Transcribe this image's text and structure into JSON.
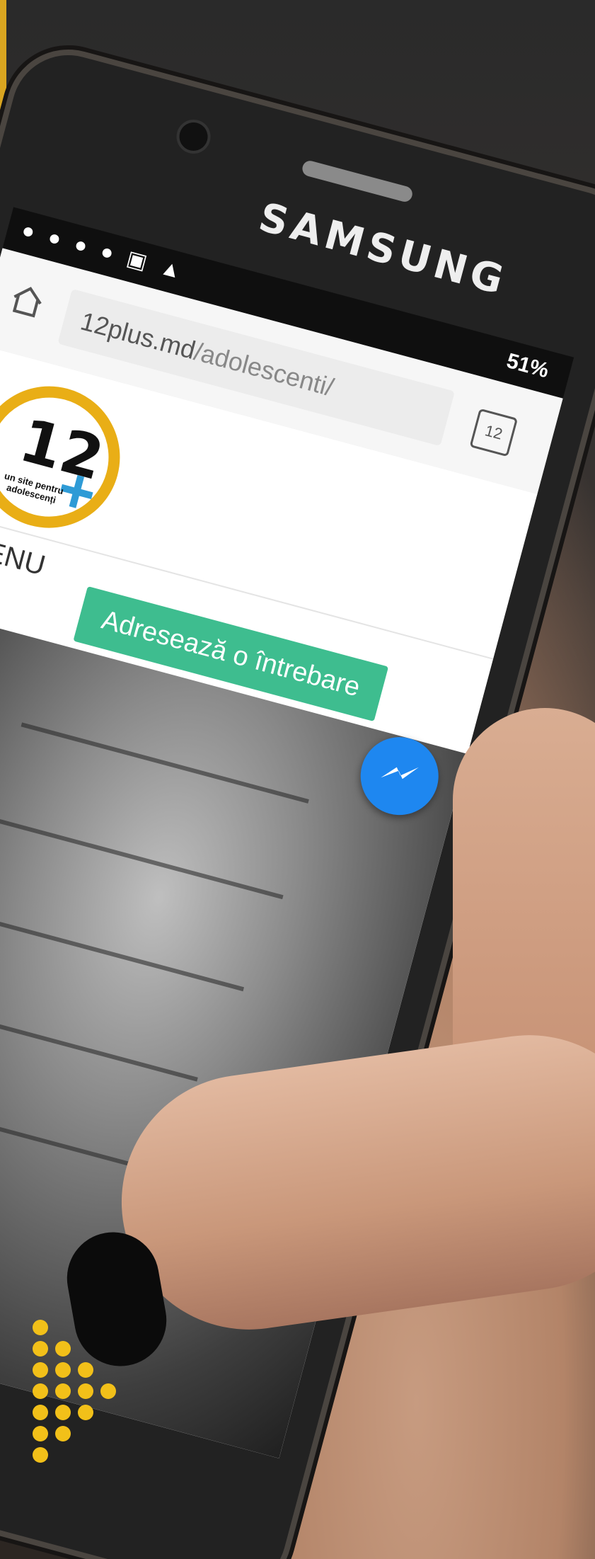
{
  "phone": {
    "brand": "SAMSUNG",
    "status": {
      "notifications": "● ● ● ● ▣ ▲",
      "battery": "51%"
    }
  },
  "browser": {
    "url_host": "12plus.md",
    "url_path": "/adolescenti/",
    "tab_count": "12"
  },
  "site": {
    "logo_number": "12",
    "logo_plus": "+",
    "logo_tagline": "un site pentru adolescenți",
    "menu_label": "☰MENU",
    "cta_label": "Adresează o întrebare"
  },
  "colors": {
    "accent_gold": "#d9a520",
    "cta_green": "#3ebd8f",
    "logo_ring": "#e9ae16",
    "logo_plus": "#2e9bd6",
    "messenger_blue": "#1e87f0"
  },
  "icons": [
    "home-icon",
    "tab-switcher-icon",
    "messenger-icon"
  ]
}
